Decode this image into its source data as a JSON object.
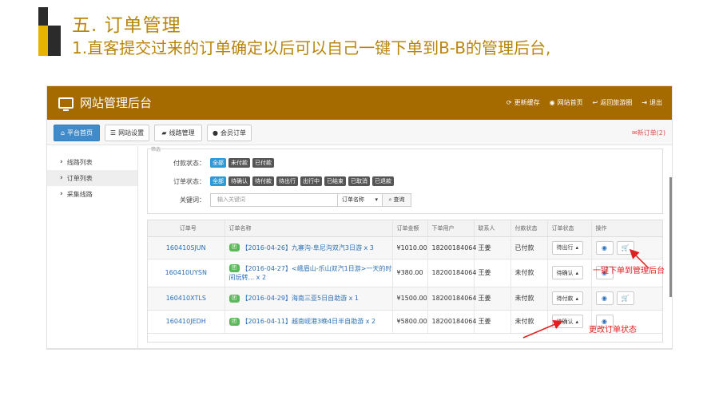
{
  "slide": {
    "title": "五. 订单管理",
    "subtitle": "1.直客提交过来的订单确定以后可以自己一键下单到B-B的管理后台,"
  },
  "app": {
    "title": "网站管理后台",
    "top_links": [
      "更新缓存",
      "网站首页",
      "返回旅游圈",
      "退出"
    ],
    "nav_tabs": [
      "平台首页",
      "网站设置",
      "线路管理",
      "会员订单"
    ],
    "new_order": "新订单(2)",
    "sidebar": [
      "线路列表",
      "订单列表",
      "采集线路"
    ]
  },
  "filters": {
    "partial_label": "筛选",
    "pay_status_label": "付款状态：",
    "pay_status_options": [
      "全部",
      "未付款",
      "已付款"
    ],
    "order_status_label": "订单状态：",
    "order_status_options": [
      "全部",
      "待确认",
      "待付款",
      "待出行",
      "出行中",
      "已结束",
      "已取消",
      "已退款"
    ],
    "keyword_label": "关键词：",
    "keyword_placeholder": "输入关键词",
    "keyword_field": "订单名称",
    "search_button": "查询"
  },
  "table": {
    "headers": [
      "订单号",
      "订单名称",
      "订单金额",
      "下单用户",
      "联系人",
      "付款状态",
      "订单状态",
      "操作"
    ],
    "rows": [
      {
        "order_no": "160410SJUN",
        "badge": "团",
        "name": "【2016-04-26】九寨沟-阜尼沟双汽3日游 x 3",
        "amount": "¥1010.00",
        "user": "18200184064",
        "contact": "王姜",
        "pay_status": "已付款",
        "order_status": "待出行"
      },
      {
        "order_no": "160410UYSN",
        "badge": "团",
        "name": "【2016-04-27】<峨眉山-乐山双汽1日游>一天的时间玩转... x 2",
        "amount": "¥380.00",
        "user": "18200184064",
        "contact": "王姜",
        "pay_status": "未付款",
        "order_status": "待确认"
      },
      {
        "order_no": "160410XTLS",
        "badge": "团",
        "name": "【2016-04-29】海南三亚5日自助游 x 1",
        "amount": "¥1500.00",
        "user": "18200184064",
        "contact": "王姜",
        "pay_status": "未付款",
        "order_status": "待付款"
      },
      {
        "order_no": "160410JEDH",
        "badge": "团",
        "name": "【2016-04-11】越南岘港3晚4日半自助游 x 2",
        "amount": "¥5800.00",
        "user": "18200184064",
        "contact": "王姜",
        "pay_status": "未付款",
        "order_status": "待确认"
      }
    ]
  },
  "annotations": {
    "one_click": "一键下单到管理后台",
    "change_status": "更改订单状态"
  },
  "colors": {
    "header_bg": "#a56a00",
    "accent_blue": "#428bca",
    "title_gold": "#b8860b",
    "annotation_red": "#e02020"
  }
}
